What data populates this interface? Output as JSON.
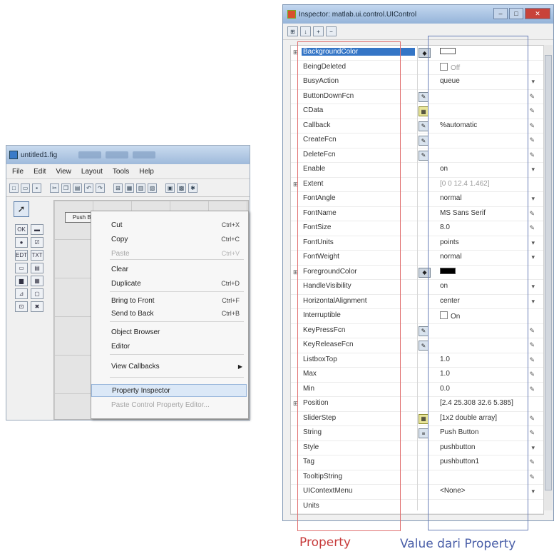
{
  "guide": {
    "title": "untitled1.fig",
    "menu": [
      "File",
      "Edit",
      "View",
      "Layout",
      "Tools",
      "Help"
    ],
    "push_button_label": "Push Bu",
    "context_menu": [
      {
        "label": "Cut",
        "shortcut": "Ctrl+X",
        "disabled": false
      },
      {
        "label": "Copy",
        "shortcut": "Ctrl+C",
        "disabled": false
      },
      {
        "label": "Paste",
        "shortcut": "Ctrl+V",
        "disabled": true
      },
      {
        "label": "Clear",
        "shortcut": "",
        "disabled": false
      },
      {
        "label": "Duplicate",
        "shortcut": "Ctrl+D",
        "disabled": false
      },
      {
        "label": "Bring to Front",
        "shortcut": "Ctrl+F",
        "disabled": false
      },
      {
        "label": "Send to Back",
        "shortcut": "Ctrl+B",
        "disabled": false
      },
      {
        "label": "Object Browser",
        "shortcut": "",
        "disabled": false
      },
      {
        "label": "Editor",
        "shortcut": "",
        "disabled": false
      },
      {
        "label": "View Callbacks",
        "shortcut": "",
        "disabled": false
      },
      {
        "label": "Property Inspector",
        "shortcut": "",
        "disabled": false
      },
      {
        "label": "Paste Control Property Editor...",
        "shortcut": "",
        "disabled": true
      }
    ]
  },
  "inspector": {
    "title": "Inspector: matlab.ui.control.UIControl",
    "rows": [
      {
        "name": "BackgroundColor",
        "btn": "color",
        "value": "",
        "swatch": "#ffffff",
        "expand": "+",
        "selected": true
      },
      {
        "name": "BeingDeleted",
        "btn": "",
        "value": "Off",
        "check": true,
        "gray": true
      },
      {
        "name": "BusyAction",
        "btn": "",
        "value": "queue",
        "edit": "▾"
      },
      {
        "name": "ButtonDownFcn",
        "btn": "edit",
        "value": "",
        "edit": "✎"
      },
      {
        "name": "CData",
        "btn": "cell",
        "value": "",
        "edit": "✎"
      },
      {
        "name": "Callback",
        "btn": "edit",
        "value": "%automatic",
        "edit": "✎"
      },
      {
        "name": "CreateFcn",
        "btn": "edit",
        "value": "",
        "edit": "✎"
      },
      {
        "name": "DeleteFcn",
        "btn": "edit",
        "value": "",
        "edit": "✎"
      },
      {
        "name": "Enable",
        "btn": "",
        "value": "on",
        "edit": "▾"
      },
      {
        "name": "Extent",
        "btn": "",
        "value": "[0 0 12.4 1.462]",
        "gray": true,
        "expand": "+"
      },
      {
        "name": "FontAngle",
        "btn": "",
        "value": "normal",
        "edit": "▾"
      },
      {
        "name": "FontName",
        "btn": "",
        "value": "MS Sans Serif",
        "edit": "✎"
      },
      {
        "name": "FontSize",
        "btn": "",
        "value": "8.0",
        "edit": "✎"
      },
      {
        "name": "FontUnits",
        "btn": "",
        "value": "points",
        "edit": "▾"
      },
      {
        "name": "FontWeight",
        "btn": "",
        "value": "normal",
        "edit": "▾"
      },
      {
        "name": "ForegroundColor",
        "btn": "color",
        "value": "",
        "swatch": "#000000",
        "expand": "+"
      },
      {
        "name": "HandleVisibility",
        "btn": "",
        "value": "on",
        "edit": "▾"
      },
      {
        "name": "HorizontalAlignment",
        "btn": "",
        "value": "center",
        "edit": "▾"
      },
      {
        "name": "Interruptible",
        "btn": "",
        "value": "On",
        "check": true
      },
      {
        "name": "KeyPressFcn",
        "btn": "edit",
        "value": "",
        "edit": "✎"
      },
      {
        "name": "KeyReleaseFcn",
        "btn": "edit",
        "value": "",
        "edit": "✎"
      },
      {
        "name": "ListboxTop",
        "btn": "",
        "value": "1.0",
        "edit": "✎"
      },
      {
        "name": "Max",
        "btn": "",
        "value": "1.0",
        "edit": "✎"
      },
      {
        "name": "Min",
        "btn": "",
        "value": "0.0",
        "edit": "✎"
      },
      {
        "name": "Position",
        "btn": "",
        "value": "[2.4 25.308 32.6 5.385]",
        "expand": "+"
      },
      {
        "name": "SliderStep",
        "btn": "cell",
        "value": "[1x2  double array]",
        "edit": "✎"
      },
      {
        "name": "String",
        "btn": "list",
        "value": "Push Button",
        "edit": "✎"
      },
      {
        "name": "Style",
        "btn": "",
        "value": "pushbutton",
        "edit": "▾"
      },
      {
        "name": "Tag",
        "btn": "",
        "value": "pushbutton1",
        "edit": "✎"
      },
      {
        "name": "TooltipString",
        "btn": "",
        "value": "",
        "edit": "✎"
      },
      {
        "name": "UIContextMenu",
        "btn": "",
        "value": "<None>",
        "edit": "▾"
      },
      {
        "name": "Units",
        "btn": "",
        "value": "",
        "edit": ""
      }
    ]
  },
  "captions": {
    "property": "Property",
    "value": "Value dari Property"
  }
}
